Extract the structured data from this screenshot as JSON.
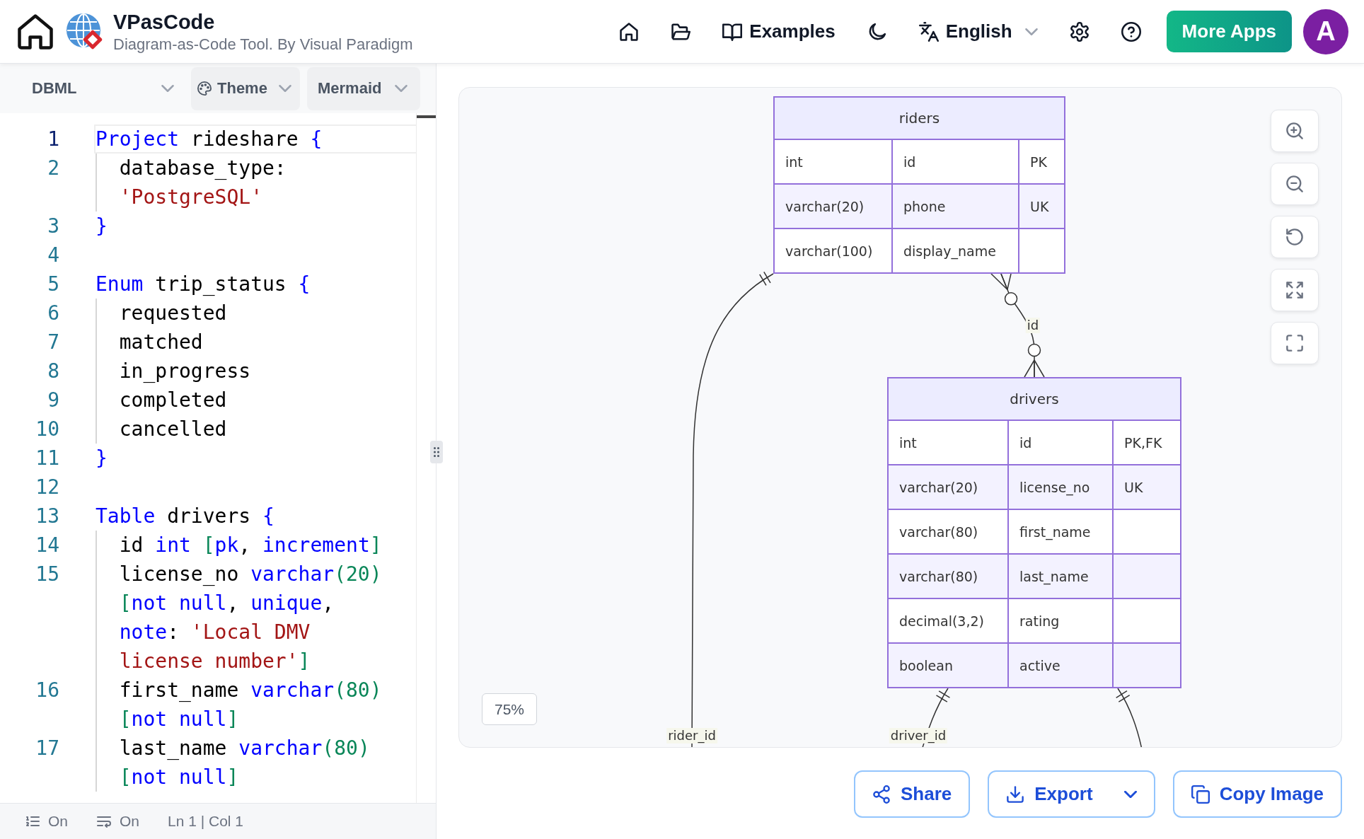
{
  "header": {
    "app_title": "VPasCode",
    "app_subtitle": "Diagram-as-Code Tool. By Visual Paradigm",
    "nav": {
      "examples_link": "Examples",
      "language_selector": "English"
    },
    "more_apps_button": "More Apps",
    "avatar_initial": "A"
  },
  "editor_toolbar": {
    "syntax_dropdown": "DBML",
    "theme_dropdown": "Theme",
    "renderer_dropdown": "Mermaid"
  },
  "editor": {
    "lines": [
      {
        "number": "1",
        "active": true,
        "rows": [
          {
            "tokens": [
              {
                "kind": "keyword",
                "text": "Project"
              },
              {
                "kind": "plain",
                "text": " rideshare "
              },
              {
                "kind": "brace",
                "text": "{"
              }
            ]
          }
        ],
        "children": [
          {
            "number": "2",
            "active": false,
            "rows": [
              {
                "tokens": [
                  {
                    "kind": "plain",
                    "text": "database_type:"
                  }
                ]
              },
              {
                "tokens": [
                  {
                    "kind": "string",
                    "text": "'PostgreSQL'"
                  }
                ]
              }
            ]
          }
        ]
      },
      {
        "number": "3",
        "active": false,
        "rows": [
          {
            "tokens": [
              {
                "kind": "brace",
                "text": "}"
              }
            ]
          }
        ]
      },
      {
        "number": "4",
        "active": false
      },
      {
        "number": "5",
        "active": false,
        "rows": [
          {
            "tokens": [
              {
                "kind": "keyword",
                "text": "Enum"
              },
              {
                "kind": "plain",
                "text": " trip_status "
              },
              {
                "kind": "brace",
                "text": "{"
              }
            ]
          }
        ],
        "children": [
          {
            "number": "6",
            "active": false,
            "rows": [
              {
                "tokens": [
                  {
                    "kind": "plain",
                    "text": "requested"
                  }
                ]
              }
            ]
          },
          {
            "number": "7",
            "active": false,
            "rows": [
              {
                "tokens": [
                  {
                    "kind": "plain",
                    "text": "matched"
                  }
                ]
              }
            ]
          },
          {
            "number": "8",
            "active": false,
            "rows": [
              {
                "tokens": [
                  {
                    "kind": "plain",
                    "text": "in_progress"
                  }
                ]
              }
            ]
          },
          {
            "number": "9",
            "active": false,
            "rows": [
              {
                "tokens": [
                  {
                    "kind": "plain",
                    "text": "completed"
                  }
                ]
              }
            ]
          },
          {
            "number": "10",
            "active": false,
            "rows": [
              {
                "tokens": [
                  {
                    "kind": "plain",
                    "text": "cancelled"
                  }
                ]
              }
            ]
          }
        ]
      },
      {
        "number": "11",
        "active": false,
        "rows": [
          {
            "tokens": [
              {
                "kind": "brace",
                "text": "}"
              }
            ]
          }
        ]
      },
      {
        "number": "12",
        "active": false
      },
      {
        "number": "13",
        "active": false,
        "rows": [
          {
            "tokens": [
              {
                "kind": "keyword",
                "text": "Table"
              },
              {
                "kind": "plain",
                "text": " drivers "
              },
              {
                "kind": "brace",
                "text": "{"
              }
            ]
          }
        ],
        "children": [
          {
            "number": "14",
            "active": false,
            "rows": [
              {
                "tokens": [
                  {
                    "kind": "plain",
                    "text": "id "
                  },
                  {
                    "kind": "keyword",
                    "text": "int "
                  },
                  {
                    "kind": "delimiter",
                    "text": "["
                  },
                  {
                    "kind": "keyword",
                    "text": "pk"
                  },
                  {
                    "kind": "plain",
                    "text": ", "
                  },
                  {
                    "kind": "keyword",
                    "text": "increment"
                  },
                  {
                    "kind": "delimiter",
                    "text": "]"
                  }
                ]
              }
            ]
          },
          {
            "number": "15",
            "active": false,
            "rows": [
              {
                "tokens": [
                  {
                    "kind": "plain",
                    "text": "license_no "
                  },
                  {
                    "kind": "keyword",
                    "text": "varchar"
                  },
                  {
                    "kind": "delimiter",
                    "text": "("
                  },
                  {
                    "kind": "number",
                    "text": "20"
                  },
                  {
                    "kind": "delimiter",
                    "text": ")"
                  }
                ]
              },
              {
                "tokens": [
                  {
                    "kind": "delimiter",
                    "text": "["
                  },
                  {
                    "kind": "keyword",
                    "text": "not null"
                  },
                  {
                    "kind": "plain",
                    "text": ", "
                  },
                  {
                    "kind": "keyword",
                    "text": "unique"
                  },
                  {
                    "kind": "plain",
                    "text": ","
                  }
                ]
              },
              {
                "tokens": [
                  {
                    "kind": "keyword",
                    "text": "note"
                  },
                  {
                    "kind": "plain",
                    "text": ": "
                  },
                  {
                    "kind": "string",
                    "text": "'Local DMV"
                  }
                ]
              },
              {
                "tokens": [
                  {
                    "kind": "string",
                    "text": "license number'"
                  },
                  {
                    "kind": "delimiter",
                    "text": "]"
                  }
                ]
              }
            ]
          },
          {
            "number": "16",
            "active": false,
            "rows": [
              {
                "tokens": [
                  {
                    "kind": "plain",
                    "text": "first_name "
                  },
                  {
                    "kind": "keyword",
                    "text": "varchar"
                  },
                  {
                    "kind": "delimiter",
                    "text": "("
                  },
                  {
                    "kind": "number",
                    "text": "80"
                  },
                  {
                    "kind": "delimiter",
                    "text": ")"
                  }
                ]
              },
              {
                "tokens": [
                  {
                    "kind": "delimiter",
                    "text": "["
                  },
                  {
                    "kind": "keyword",
                    "text": "not null"
                  },
                  {
                    "kind": "delimiter",
                    "text": "]"
                  }
                ]
              }
            ]
          },
          {
            "number": "17",
            "active": false,
            "rows": [
              {
                "tokens": [
                  {
                    "kind": "plain",
                    "text": "last_name "
                  },
                  {
                    "kind": "keyword",
                    "text": "varchar"
                  },
                  {
                    "kind": "delimiter",
                    "text": "("
                  },
                  {
                    "kind": "number",
                    "text": "80"
                  },
                  {
                    "kind": "delimiter",
                    "text": ")"
                  }
                ]
              },
              {
                "tokens": [
                  {
                    "kind": "delimiter",
                    "text": "["
                  },
                  {
                    "kind": "keyword",
                    "text": "not null"
                  },
                  {
                    "kind": "delimiter",
                    "text": "]"
                  }
                ]
              }
            ]
          }
        ]
      }
    ]
  },
  "status_bar": {
    "line_numbers_toggle": "On",
    "word_wrap_toggle": "On",
    "cursor_position": "Ln 1 | Col 1"
  },
  "diagram": {
    "tables": [
      {
        "name": "riders",
        "columns": [
          {
            "type": "int",
            "name": "id",
            "key": "PK"
          },
          {
            "type": "varchar(20)",
            "name": "phone",
            "key": "UK"
          },
          {
            "type": "varchar(100)",
            "name": "display_name"
          }
        ]
      },
      {
        "name": "drivers",
        "columns": [
          {
            "type": "int",
            "name": "id",
            "key": "PK,FK"
          },
          {
            "type": "varchar(20)",
            "name": "license_no",
            "key": "UK"
          },
          {
            "type": "varchar(80)",
            "name": "first_name"
          },
          {
            "type": "varchar(80)",
            "name": "last_name"
          },
          {
            "type": "decimal(3,2)",
            "name": "rating"
          },
          {
            "type": "boolean",
            "name": "active"
          }
        ]
      }
    ],
    "relationships": [
      {
        "kind": "bar",
        "label": "rider_id"
      },
      {
        "kind": "crowfoot",
        "label": "id"
      },
      {
        "kind": "bar",
        "label": "driver_id"
      },
      {
        "kind": "bar"
      }
    ],
    "zoom_level": "75%"
  },
  "actions": {
    "share_button": "Share",
    "export_button": "Export",
    "copy_image_button": "Copy Image"
  }
}
